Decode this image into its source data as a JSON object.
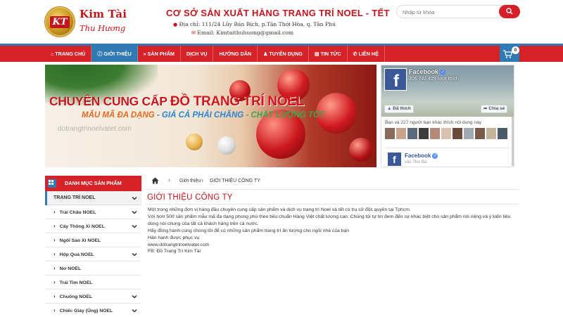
{
  "header": {
    "logo_badge": "KT",
    "logo_name": "Kim Tài",
    "logo_sub": "Thu Hương",
    "site_title": "CƠ SỞ SẢN XUẤT HÀNG TRANG TRÍ NOEL - TẾT",
    "address": "Địa chỉ: 111/24 Lũy Bán Bích, p.Tân Thới Hòa, q. Tân Phú",
    "email": "Email: Kimtaithuhuong@gmail.com",
    "search_placeholder": "Nhập từ khóa"
  },
  "nav": {
    "items": [
      {
        "label": "TRANG CHỦ",
        "icon": "home-icon"
      },
      {
        "label": "GIỚI THIỆU",
        "icon": "info-icon"
      },
      {
        "label": "SẢN PHẨM",
        "icon": "double-chevron-icon"
      },
      {
        "label": "DỊCH VỤ",
        "icon": ""
      },
      {
        "label": "HƯỚNG DẪN",
        "icon": ""
      },
      {
        "label": "TUYỂN DỤNG",
        "icon": "users-icon"
      },
      {
        "label": "TIN TỨC",
        "icon": "news-icon"
      },
      {
        "label": "LIÊN HỆ",
        "icon": "phone-icon"
      }
    ],
    "cart_count": "0"
  },
  "banner": {
    "line1_prefix": "CHUYÊN CUNG CẤP ",
    "line1_strong": "ĐỒ TRANG TRÍ NOEL",
    "line2_a": "MẪU MÃ ĐA DẠNG",
    "line2_b": " - GIÁ CẢ PHẢI CHĂNG",
    "line2_c": " - CHẤT LƯỢNG TỐT",
    "watermark": "dotrangtrinoelvatet.com"
  },
  "facebook": {
    "page_name": "Facebook",
    "likes": "206.742.429 lượt thích",
    "liked_btn": "Đã thích",
    "share_btn": "Chia sẻ",
    "friends_text": "Bạn và 227 người bạn khác thích nội dung này",
    "post_name": "Facebook",
    "post_time": "vào Thứ Ba"
  },
  "sidebar": {
    "heading": "DANH MỤC SẢN PHẨM",
    "main_category": "TRANG TRÍ NOEL",
    "items": [
      {
        "label": "Trái Châu NOEL",
        "has_chevron": true
      },
      {
        "label": "Cây Thông Xi NOEL",
        "has_chevron": true
      },
      {
        "label": "Ngôi Sao Xi NOEL",
        "has_chevron": false
      },
      {
        "label": "Hộp Quà NOEL",
        "has_chevron": true
      },
      {
        "label": "Nơ NOEL",
        "has_chevron": false
      },
      {
        "label": "Trái Tim NOEL",
        "has_chevron": false
      },
      {
        "label": "Chuông NOEL",
        "has_chevron": true
      },
      {
        "label": "Chiếc Giày (Ủng) NOEL",
        "has_chevron": true
      }
    ]
  },
  "breadcrumb": {
    "level1": "Giới thiệu",
    "level2": "GIỚI THIỆU CÔNG TY"
  },
  "content": {
    "title": "GIỚI THIỆU CÔNG TY",
    "paragraphs": [
      "Một trong những đơn vị hàng đầu chuyên cung cấp sản phẩm và dịch vụ trang trí Noel và tết có trụ sở độc quyền tại Tphcm.",
      "Với hơn 500 sản phẩm mẫu mã đa dạng phong phú theo tiêu chuẩn Hàng Việt chất lượng cao. Chúng tôi tự tin đem đến sự khác biệt cho sản phẩm nói riêng và ý kiến tiêu dùng nói chung của tất cả khách hàng trên cả nước.",
      "Hãy đồng hành cùng chúng tôi  để có những sản phẩm trang trí ấn tượng cho ngôi nhà của bạn",
      "Hân hạnh được phục vụ",
      "www.dotrangtrinoelvatet.com",
      "FB: Đồ Trang Trí Kim Tài"
    ]
  },
  "colors": {
    "brand_red": "#d6232a",
    "brand_blue": "#2f7ab3",
    "facebook_blue": "#3b5998"
  }
}
